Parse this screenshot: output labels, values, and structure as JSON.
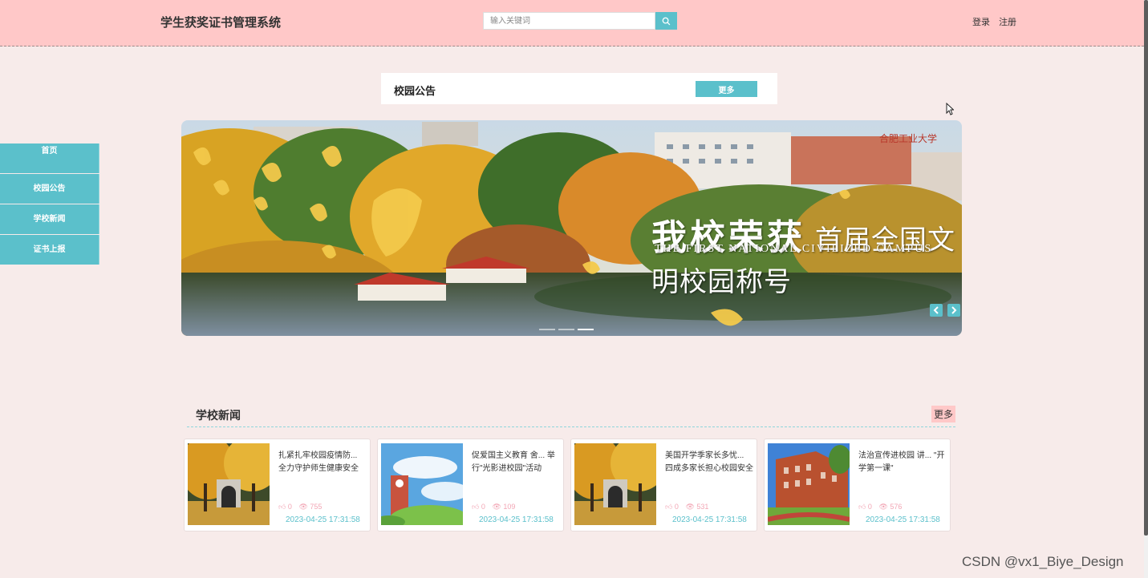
{
  "header": {
    "site_title": "学生获奖证书管理系统",
    "search_placeholder": "输入关键词",
    "login": "登录",
    "register": "注册"
  },
  "notice": {
    "title": "校园公告",
    "more": "更多"
  },
  "sidebar": {
    "items": [
      {
        "label": "首页"
      },
      {
        "label": "校园公告"
      },
      {
        "label": "学校新闻"
      },
      {
        "label": "证书上报"
      }
    ]
  },
  "banner": {
    "headline_big": "我校荣获",
    "headline": "首届全国文明校园称号",
    "subtitle": "THE FIRST NATIONAL CIVILIZED CAMPUS",
    "logo_text": "合肥工业大学",
    "slide_count": 3,
    "active_slide": 3
  },
  "news": {
    "title": "学校新闻",
    "more": "更多",
    "items": [
      {
        "title": "扎紧扎牢校园疫情防... 全力守护师生健康安全",
        "likes": "0",
        "views": "755",
        "date": "2023-04-25 17:31:58",
        "image": "ginkgo-gate"
      },
      {
        "title": "促爱国主义教育 舍... 举行\"光影进校园\"活动",
        "likes": "0",
        "views": "109",
        "date": "2023-04-25 17:31:58",
        "image": "clock-tower"
      },
      {
        "title": "美国开学季家长多忧... 四成多家长担心校园安全",
        "likes": "0",
        "views": "531",
        "date": "2023-04-25 17:31:58",
        "image": "ginkgo-gate"
      },
      {
        "title": "法治宣传进校园 讲... \"开学第一课\"",
        "likes": "0",
        "views": "576",
        "date": "2023-04-25 17:31:58",
        "image": "red-building"
      }
    ]
  },
  "watermark": "CSDN @vx1_Biye_Design",
  "colors": {
    "header_bg": "#ffc8c8",
    "accent": "#5bc0cb",
    "page_bg": "#f7ebea"
  }
}
